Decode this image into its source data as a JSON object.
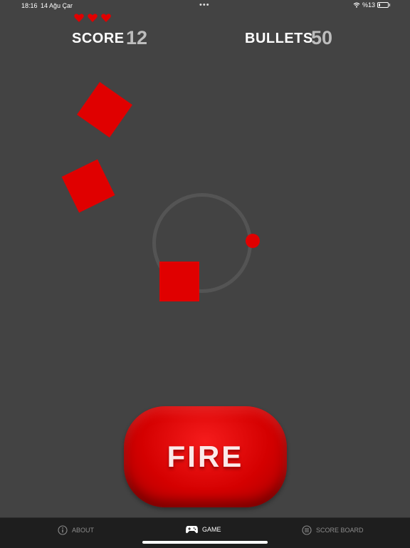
{
  "status": {
    "time": "18:16",
    "date": "14 Ağu Çar",
    "battery": "%13",
    "battery_level": 0.13
  },
  "hud": {
    "lives": 3,
    "score_label": "SCORE",
    "score_value": "12",
    "bullets_label": "BULLETS",
    "bullets_value": "50"
  },
  "fire_button": {
    "label": "FIRE"
  },
  "tabs": [
    {
      "label": "ABOUT",
      "icon": "info-icon"
    },
    {
      "label": "GAME",
      "icon": "gamepad-icon",
      "active": true
    },
    {
      "label": "SCORE BOARD",
      "icon": "list-icon"
    }
  ],
  "colors": {
    "background": "#434343",
    "accent": "#e00000",
    "tab_bar": "#1e1e1e"
  }
}
